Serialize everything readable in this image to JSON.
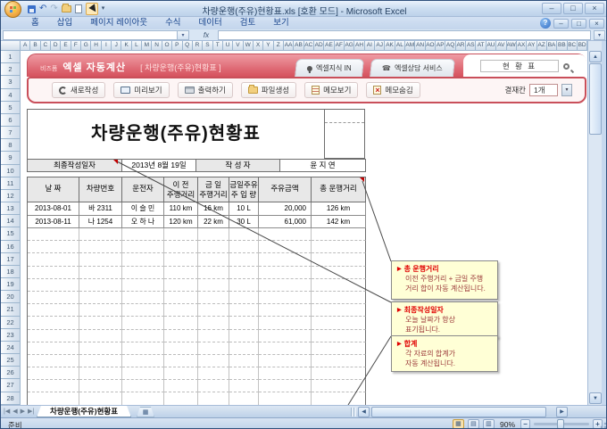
{
  "window": {
    "title": "차량운행(주유)현황표.xls  [호환 모드] - Microsoft Excel"
  },
  "icons": {
    "minimize-icon": "–",
    "maximize-icon": "□",
    "close-icon": "×",
    "help-icon": "?",
    "undo-icon": "↶",
    "redo-icon": "↷",
    "dropdown-icon": "▾",
    "scroll-up-icon": "▲",
    "scroll-down-icon": "▼",
    "scroll-left-icon": "◀",
    "scroll-right-icon": "▶",
    "nav-first-icon": "|◀",
    "nav-prev-icon": "◀",
    "nav-next-icon": "▶",
    "nav-last-icon": "▶|",
    "view-normal-icon": "▦",
    "view-layout-icon": "▤",
    "view-break-icon": "▥",
    "zoom-out-icon": "−",
    "zoom-in-icon": "+",
    "formula-expand-icon": "▾",
    "fx-label": "fx",
    "add-sheet-icon": "▦"
  },
  "ribbon": {
    "tabs": [
      "홈",
      "삽입",
      "페이지 레이아웃",
      "수식",
      "데이터",
      "검토",
      "보기"
    ]
  },
  "banner": {
    "brand_small": "비즈폼",
    "brand": "엑셀 자동계산",
    "doc_label": "[ 차량운행(주유)현황표 ]",
    "tabs": [
      {
        "icon": "pin-icon",
        "label": "엑셀지식 IN"
      },
      {
        "icon": "phone-icon",
        "label": "엑셀상담 서비스"
      }
    ],
    "search_value": "현 황 표",
    "buttons": [
      {
        "icon": "refresh-icon",
        "label": "새로작성"
      },
      {
        "icon": "preview-icon",
        "label": "미리보기"
      },
      {
        "icon": "print-icon",
        "label": "출력하기"
      },
      {
        "icon": "file-icon",
        "label": "파일생성"
      },
      {
        "icon": "memo-icon",
        "label": "메모보기"
      },
      {
        "icon": "memo-hide-icon",
        "label": "메모숨김"
      }
    ],
    "approval_label": "결재칸",
    "approval_value": "1개"
  },
  "doc": {
    "title": "차량운행(주유)현황표",
    "info": [
      {
        "text": "최종작성일자",
        "header": true
      },
      {
        "text": "2013년 8월 19일",
        "header": false
      },
      {
        "text": "작 성 자",
        "header": true
      },
      {
        "text": "윤 지 연",
        "header": false
      }
    ],
    "table": {
      "headers": [
        "날    짜",
        "차량번호",
        "운전자",
        "이  전\n주행거리",
        "금  일\n주행거리",
        "금일주유\n주 입 량",
        "주유금액",
        "총 운행거리"
      ],
      "rows": [
        [
          "2013-08-01",
          "바 2311",
          "이 슬 민",
          "110 km",
          "16 km",
          "10 L",
          "20,000",
          "126 km"
        ],
        [
          "2013-08-11",
          "나 1254",
          "오 하 나",
          "120 km",
          "22 km",
          "30 L",
          "61,000",
          "142 km"
        ]
      ]
    }
  },
  "comments": [
    {
      "title": "총 운행거리",
      "body": "이전 주행거리 + 금일 주행\n거리 합이 자동 계산됩니다."
    },
    {
      "title": "최종작성일자",
      "body": "오늘 날짜가 항상\n표기됩니다."
    },
    {
      "title": "합계",
      "body": "각 자료의 합계가\n자동 계산됩니다."
    }
  ],
  "sheet": {
    "columns": [
      "A",
      "B",
      "C",
      "D",
      "E",
      "F",
      "G",
      "H",
      "I",
      "J",
      "K",
      "L",
      "M",
      "N",
      "O",
      "P",
      "Q",
      "R",
      "S",
      "T",
      "U",
      "V",
      "W",
      "X",
      "Y",
      "Z",
      "AA",
      "AB",
      "AC",
      "AD",
      "AE",
      "AF",
      "AG",
      "AH",
      "AI",
      "AJ",
      "AK",
      "AL",
      "AM",
      "AN",
      "AO",
      "AP",
      "AQ",
      "AR",
      "AS",
      "AT",
      "AU",
      "AV",
      "AW",
      "AX",
      "AY",
      "AZ",
      "BA",
      "BB",
      "BC",
      "BD"
    ],
    "row_count": 28,
    "tab_label": "차량운행(주유)현황표"
  },
  "status": {
    "ready": "준비",
    "zoom": "90%"
  }
}
